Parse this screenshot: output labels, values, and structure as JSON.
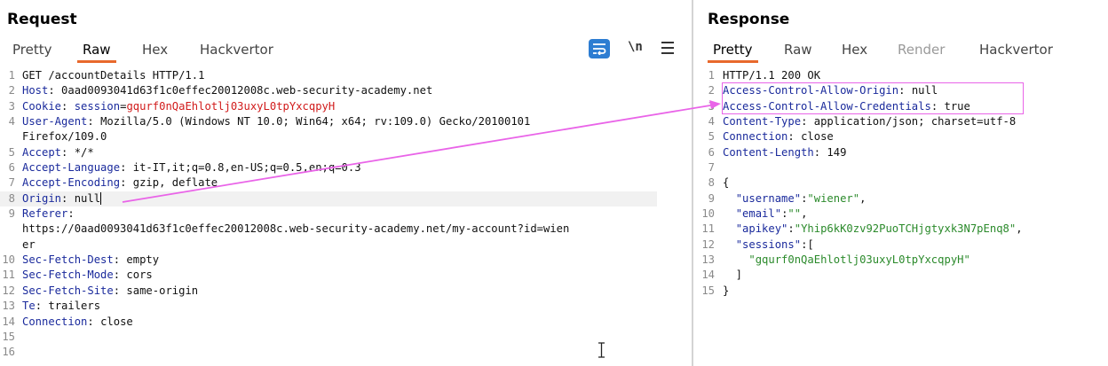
{
  "request": {
    "title": "Request",
    "tabs": [
      "Pretty",
      "Raw",
      "Hex",
      "Hackvertor"
    ],
    "selected_tab": "Raw",
    "toolbar": {
      "newline_label": "\\n"
    },
    "lines": [
      {
        "n": "1",
        "k": "",
        "sep": "",
        "v": "GET /accountDetails HTTP/1.1"
      },
      {
        "n": "2",
        "k": "Host",
        "sep": ": ",
        "v": "0aad0093041d63f1c0effec20012008c.web-security-academy.net"
      },
      {
        "n": "3",
        "k": "Cookie",
        "sep": ": ",
        "ck": "session",
        "ce": "=",
        "cv": "gqurf0nQaEhlotlj03uxyL0tpYxcqpyH"
      },
      {
        "n": "4",
        "k": "User-Agent",
        "sep": ": ",
        "v": "Mozilla/5.0 (Windows NT 10.0; Win64; x64; rv:109.0) Gecko/20100101"
      },
      {
        "n": "",
        "k": "",
        "sep": "",
        "v": "Firefox/109.0"
      },
      {
        "n": "5",
        "k": "Accept",
        "sep": ": ",
        "v": "*/*"
      },
      {
        "n": "6",
        "k": "Accept-Language",
        "sep": ": ",
        "v": "it-IT,it;q=0.8,en-US;q=0.5,en;q=0.3"
      },
      {
        "n": "7",
        "k": "Accept-Encoding",
        "sep": ": ",
        "v": "gzip, deflate"
      },
      {
        "n": "8",
        "k": "Origin",
        "sep": ": ",
        "v": "null",
        "hl": true
      },
      {
        "n": "9",
        "k": "Referer",
        "sep": ":",
        "v": ""
      },
      {
        "n": "",
        "k": "",
        "sep": "",
        "v": "https://0aad0093041d63f1c0effec20012008c.web-security-academy.net/my-account?id=wien"
      },
      {
        "n": "",
        "k": "",
        "sep": "",
        "v": "er"
      },
      {
        "n": "10",
        "k": "Sec-Fetch-Dest",
        "sep": ": ",
        "v": "empty"
      },
      {
        "n": "11",
        "k": "Sec-Fetch-Mode",
        "sep": ": ",
        "v": "cors"
      },
      {
        "n": "12",
        "k": "Sec-Fetch-Site",
        "sep": ": ",
        "v": "same-origin"
      },
      {
        "n": "13",
        "k": "Te",
        "sep": ": ",
        "v": "trailers"
      },
      {
        "n": "14",
        "k": "Connection",
        "sep": ": ",
        "v": "close"
      },
      {
        "n": "15",
        "k": "",
        "sep": "",
        "v": ""
      },
      {
        "n": "16",
        "k": "",
        "sep": "",
        "v": ""
      }
    ]
  },
  "response": {
    "title": "Response",
    "tabs": [
      "Pretty",
      "Raw",
      "Hex",
      "Render",
      "Hackvertor"
    ],
    "selected_tab": "Pretty",
    "disabled_tab": "Render",
    "lines": [
      {
        "n": "1",
        "k": "",
        "sep": "",
        "v": "HTTP/1.1 200 OK"
      },
      {
        "n": "2",
        "k": "Access-Control-Allow-Origin",
        "sep": ": ",
        "v": "null"
      },
      {
        "n": "3",
        "k": "Access-Control-Allow-Credentials",
        "sep": ": ",
        "v": "true"
      },
      {
        "n": "4",
        "k": "Content-Type",
        "sep": ": ",
        "v": "application/json; charset=utf-8"
      },
      {
        "n": "5",
        "k": "Connection",
        "sep": ": ",
        "v": "close"
      },
      {
        "n": "6",
        "k": "Content-Length",
        "sep": ": ",
        "v": "149"
      },
      {
        "n": "7",
        "k": "",
        "sep": "",
        "v": ""
      },
      {
        "n": "8",
        "k": "",
        "sep": "",
        "v": "{"
      },
      {
        "n": "9",
        "jk": "\"username\"",
        "jc": ":",
        "jv": "\"wiener\"",
        "je": ","
      },
      {
        "n": "10",
        "jk": "\"email\"",
        "jc": ":",
        "jv": "\"\"",
        "je": ","
      },
      {
        "n": "11",
        "jk": "\"apikey\"",
        "jc": ":",
        "jv": "\"Yhip6kK0zv92PuoTCHjgtyxk3N7pEnq8\"",
        "je": ","
      },
      {
        "n": "12",
        "jk": "\"sessions\"",
        "jc": ":",
        "jv": "[",
        "je": ""
      },
      {
        "n": "13",
        "k": "",
        "sep": "",
        "v": "    ",
        "sv": "\"gqurf0nQaEhlotlj03uxyL0tpYxcqpyH\""
      },
      {
        "n": "14",
        "k": "",
        "sep": "",
        "v": "  ]"
      },
      {
        "n": "15",
        "k": "",
        "sep": "",
        "v": "}"
      }
    ]
  },
  "colors": {
    "accent": "#e8692c",
    "annotation": "#e964e8",
    "header_key": "#1a2a9c",
    "cookie_value": "#d11b1b",
    "json_string": "#2b8a2b"
  }
}
